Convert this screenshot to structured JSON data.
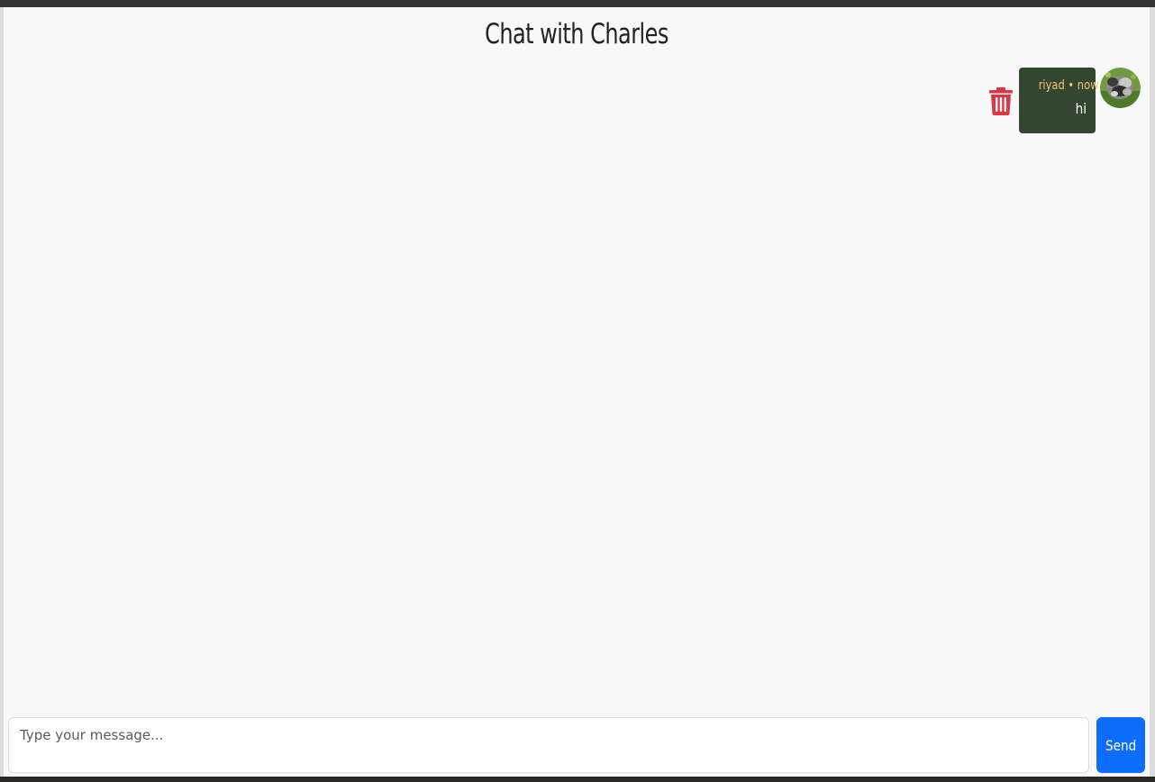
{
  "chat": {
    "title": "Chat with Charles"
  },
  "messages": [
    {
      "author": "riyad",
      "time": "now",
      "meta": "riyad • now",
      "text": "hi",
      "delete_icon": "trash-icon",
      "avatar": "user-avatar-photo"
    }
  ],
  "composer": {
    "placeholder": "Type your message...",
    "value": "",
    "send_label": "Send"
  },
  "colors": {
    "bubble_bg": "#334630",
    "bubble_meta": "#f4c27a",
    "delete_icon": "#dc3545",
    "send_button": "#0d6efd",
    "panel_bg": "#f8f8f8"
  }
}
